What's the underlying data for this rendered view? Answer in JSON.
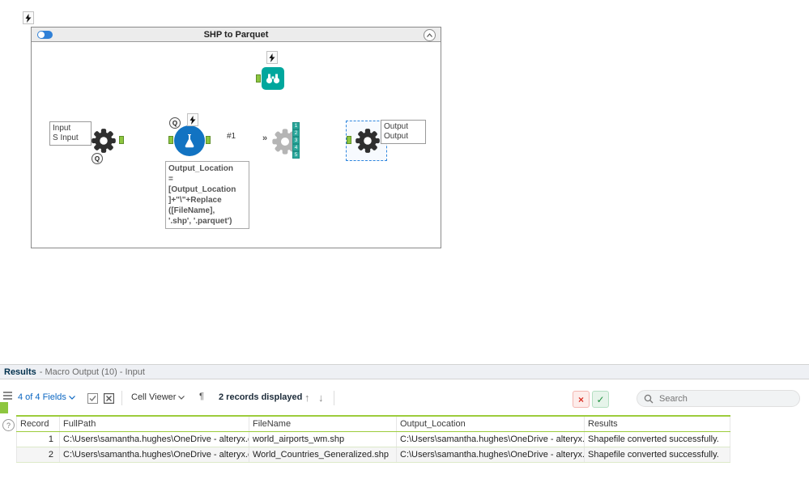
{
  "workflow": {
    "title": "SHP to Parquet",
    "q_label": "Q",
    "input_box": [
      "Input",
      "S Input"
    ],
    "output_box": [
      "Output",
      "Output"
    ],
    "connection_label": "#1",
    "multi_in": "»",
    "annotation": [
      "Output_Location",
      "=",
      "[Output_Location",
      "]+\"\\\"+Replace",
      "([FileName],",
      "'.shp', '.parquet')"
    ],
    "stack": [
      "1",
      "2",
      "3",
      "4",
      "5"
    ],
    "colors": {
      "anchor_green": "#8dc63f",
      "formula_blue": "#1273c2",
      "browse_teal": "#00a79d",
      "selection_blue": "#2e86de"
    }
  },
  "results": {
    "title": "Results",
    "subtitle": "- Macro Output (10) - Input",
    "toolbar": {
      "fields_label": "4 of 4 Fields",
      "cell_viewer_label": "Cell Viewer",
      "records_label": "2 records displayed",
      "search_placeholder": "Search",
      "up_arrow": "↑",
      "down_arrow": "↓",
      "pilcrow": "¶",
      "x_glyph": "×",
      "check_glyph": "✓",
      "help_glyph": "?"
    },
    "table": {
      "columns": [
        "Record",
        "FullPath",
        "FileName",
        "Output_Location",
        "Results"
      ],
      "rows": [
        [
          "1",
          "C:\\Users\\samantha.hughes\\OneDrive - alteryx.co...",
          "world_airports_wm.shp",
          "C:\\Users\\samantha.hughes\\OneDrive - alteryx.co...",
          "Shapefile converted successfully."
        ],
        [
          "2",
          "C:\\Users\\samantha.hughes\\OneDrive - alteryx.co...",
          "World_Countries_Generalized.shp",
          "C:\\Users\\samantha.hughes\\OneDrive - alteryx.co...",
          "Shapefile converted successfully."
        ]
      ]
    }
  }
}
